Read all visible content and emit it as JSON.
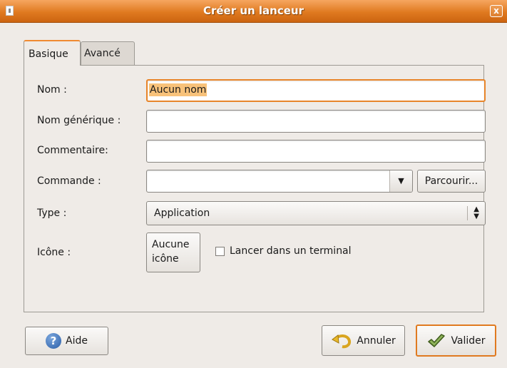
{
  "window": {
    "title": "Créer un lanceur",
    "close_glyph": "x"
  },
  "tabs": [
    {
      "label": "Basique",
      "active": true
    },
    {
      "label": "Avancé",
      "active": false
    }
  ],
  "fields": {
    "nom": {
      "label": "Nom :",
      "value": "Aucun nom"
    },
    "nom_generique": {
      "label": "Nom générique :",
      "value": ""
    },
    "commentaire": {
      "label": "Commentaire:",
      "value": ""
    },
    "commande": {
      "label": "Commande :",
      "value": "",
      "browse_label": "Parcourir..."
    },
    "type": {
      "label": "Type :",
      "selected": "Application"
    },
    "icone": {
      "label": "Icône :",
      "button_line1": "Aucune",
      "button_line2": "icône"
    },
    "terminal": {
      "label": "Lancer dans un terminal",
      "checked": false
    }
  },
  "buttons": {
    "help": "Aide",
    "cancel": "Annuler",
    "ok": "Valider"
  },
  "colors": {
    "accent": "#e07a20",
    "selection": "#f8c27a",
    "background": "#efebe7"
  }
}
